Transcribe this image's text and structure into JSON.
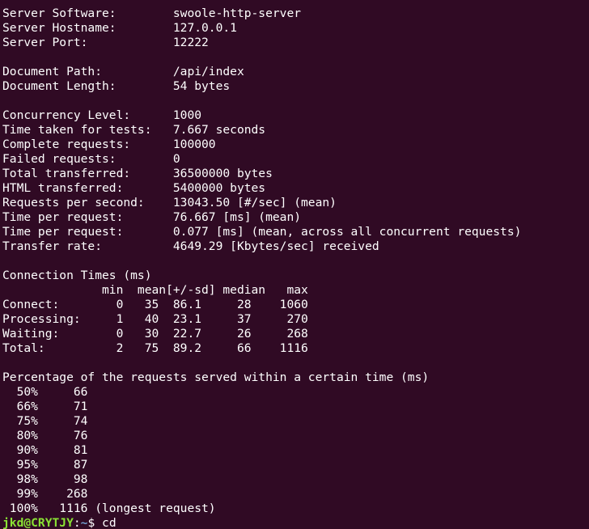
{
  "lines": [
    "Server Software:        swoole-http-server",
    "Server Hostname:        127.0.0.1",
    "Server Port:            12222",
    "",
    "Document Path:          /api/index",
    "Document Length:        54 bytes",
    "",
    "Concurrency Level:      1000",
    "Time taken for tests:   7.667 seconds",
    "Complete requests:      100000",
    "Failed requests:        0",
    "Total transferred:      36500000 bytes",
    "HTML transferred:       5400000 bytes",
    "Requests per second:    13043.50 [#/sec] (mean)",
    "Time per request:       76.667 [ms] (mean)",
    "Time per request:       0.077 [ms] (mean, across all concurrent requests)",
    "Transfer rate:          4649.29 [Kbytes/sec] received",
    "",
    "Connection Times (ms)",
    "              min  mean[+/-sd] median   max",
    "Connect:        0   35  86.1     28    1060",
    "Processing:     1   40  23.1     37     270",
    "Waiting:        0   30  22.7     26     268",
    "Total:          2   75  89.2     66    1116",
    "",
    "Percentage of the requests served within a certain time (ms)",
    "  50%     66",
    "  66%     71",
    "  75%     74",
    "  80%     76",
    "  90%     81",
    "  95%     87",
    "  98%     98",
    "  99%    268",
    " 100%   1116 (longest request)"
  ],
  "prompt": {
    "user_host": "jkd@CRYTJY",
    "separator": ":",
    "path": "~",
    "symbol": "$ ",
    "command": "cd"
  },
  "colors": {
    "background": "#300a24",
    "text": "#ffffff",
    "prompt_user": "#8ae234",
    "prompt_path": "#729fcf"
  }
}
